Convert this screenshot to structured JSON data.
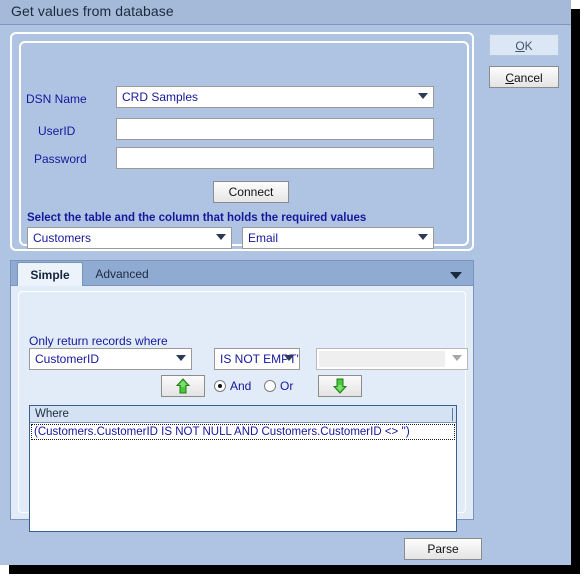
{
  "window": {
    "title": "Get values from database"
  },
  "commands": {
    "ok": {
      "label": "OK",
      "mnemonic": "O",
      "rest": "K"
    },
    "cancel": {
      "label": "Cancel",
      "mnemonic": "C",
      "rest": "ancel"
    }
  },
  "connection": {
    "dsn_label": "DSN Name",
    "dsn_value": "CRD Samples",
    "userid_label": "UserID",
    "userid_value": "",
    "userid_placeholder": "",
    "password_label": "Password",
    "password_value": "",
    "password_placeholder": "",
    "connect_label": "Connect",
    "select_hint": "Select the table and the column that holds the required values",
    "table_value": "Customers",
    "column_value": "Email"
  },
  "tabs": {
    "items": [
      {
        "label": "Simple",
        "active": true
      },
      {
        "label": "Advanced",
        "active": false
      }
    ],
    "overflow_icon": "chevron-down-icon"
  },
  "simple_tab": {
    "only_return_label": "Only return records where",
    "field_value": "CustomerID",
    "operator_value": "IS NOT EMPT'",
    "value_value": "",
    "move_up_icon": "arrow-up-icon",
    "move_down_icon": "arrow-down-icon",
    "radio_and_label": "And",
    "radio_or_label": "Or",
    "radio_selected": "And",
    "where_header": "Where",
    "where_rows": [
      "(Customers.CustomerID IS NOT NULL AND Customers.CustomerID <> '')"
    ]
  },
  "footer": {
    "parse_label": "Parse"
  },
  "colors": {
    "window_background": "#aec4e2",
    "titlebar": "#a4bad8",
    "tabstrip": "#8fabd2",
    "tabpage": "#e2ecf8",
    "label_text": "#16179c",
    "arrow_green": "#44c436",
    "list_border": "#3c5d8f"
  }
}
